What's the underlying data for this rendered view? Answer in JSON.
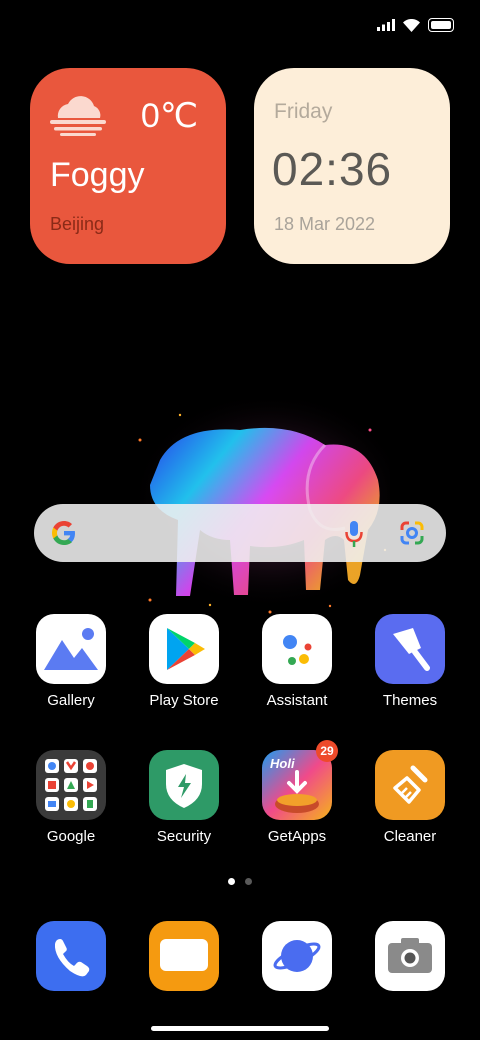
{
  "status_bar": {
    "signal_icon": "signal-icon",
    "wifi_icon": "wifi-icon",
    "battery_icon": "battery-icon"
  },
  "weather_widget": {
    "temperature": "0℃",
    "condition": "Foggy",
    "city": "Beijing",
    "icon": "fog-icon",
    "color": "#e9573d"
  },
  "clock_widget": {
    "day": "Friday",
    "time": "02:36",
    "date": "18 Mar 2022",
    "color": "#fdeed9"
  },
  "search_bar": {
    "logo": "google-logo",
    "mic_icon": "mic-icon",
    "lens_icon": "lens-icon"
  },
  "apps": [
    {
      "label": "Gallery",
      "icon": "gallery-icon"
    },
    {
      "label": "Play Store",
      "icon": "play-store-icon"
    },
    {
      "label": "Assistant",
      "icon": "assistant-icon"
    },
    {
      "label": "Themes",
      "icon": "themes-icon"
    },
    {
      "label": "Google",
      "icon": "google-folder-icon"
    },
    {
      "label": "Security",
      "icon": "security-icon"
    },
    {
      "label": "GetApps",
      "icon": "getapps-icon",
      "badge": "29",
      "banner": "Holi"
    },
    {
      "label": "Cleaner",
      "icon": "cleaner-icon"
    }
  ],
  "page_indicator": {
    "pages": 2,
    "current": 1
  },
  "dock": [
    {
      "icon": "phone-icon"
    },
    {
      "icon": "messages-icon"
    },
    {
      "icon": "browser-icon"
    },
    {
      "icon": "camera-icon"
    }
  ]
}
